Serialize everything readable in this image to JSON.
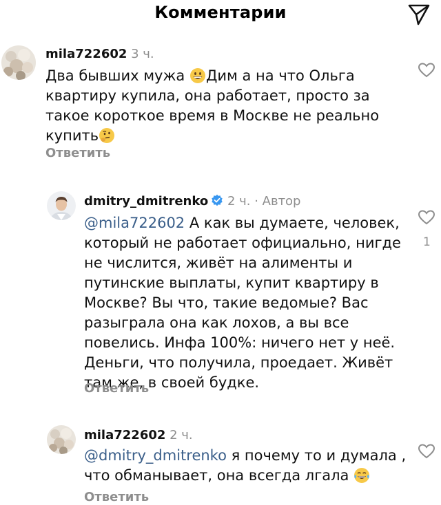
{
  "header": {
    "title": "Комментарии",
    "send_icon": "send-icon"
  },
  "comments": [
    {
      "username": "mila722602",
      "time": "3 ч.",
      "lines": [
        {
          "pre": "Два бывших мужа ",
          "emoji": "grinning-face-emoji",
          "post": "Дим  а на что Ольга"
        },
        {
          "text": "квартиру купила, она работает, просто за"
        },
        {
          "text": "такое короткое время в Москве не реально"
        },
        {
          "pre": "купить",
          "emoji": "thinking-face-emoji"
        }
      ],
      "reply_label": "Ответить"
    },
    {
      "username": "dmitry_dmitrenko",
      "time": "2 ч.",
      "separator": " · ",
      "author_label": "Автор",
      "mention": "@mila722602",
      "line1_rest": " А как вы думаете, человек,",
      "lines": [
        "который не работает официально, нигде",
        "не числится, живёт на алименты и",
        "путинские выплаты, купит квартиру в",
        "Москве? Вы что, такие ведомые? Вас",
        "разыграла она как лохов, а вы все",
        "повелись. Инфа 100%: ничего нет у неё.",
        "Деньги, что получила, проедает. Живёт",
        "там же, в своей будке."
      ],
      "reply_label": "Ответить",
      "like_count": "1"
    },
    {
      "username": "mila722602",
      "time": "2 ч.",
      "mention": "@dmitry_dmitrenko",
      "line1_rest": " я почему то и думала ,",
      "line2_text": "что обманывает, она всегда лгала ",
      "line2_emoji": "tears-of-joy-emoji",
      "reply_label": "Ответить"
    }
  ]
}
